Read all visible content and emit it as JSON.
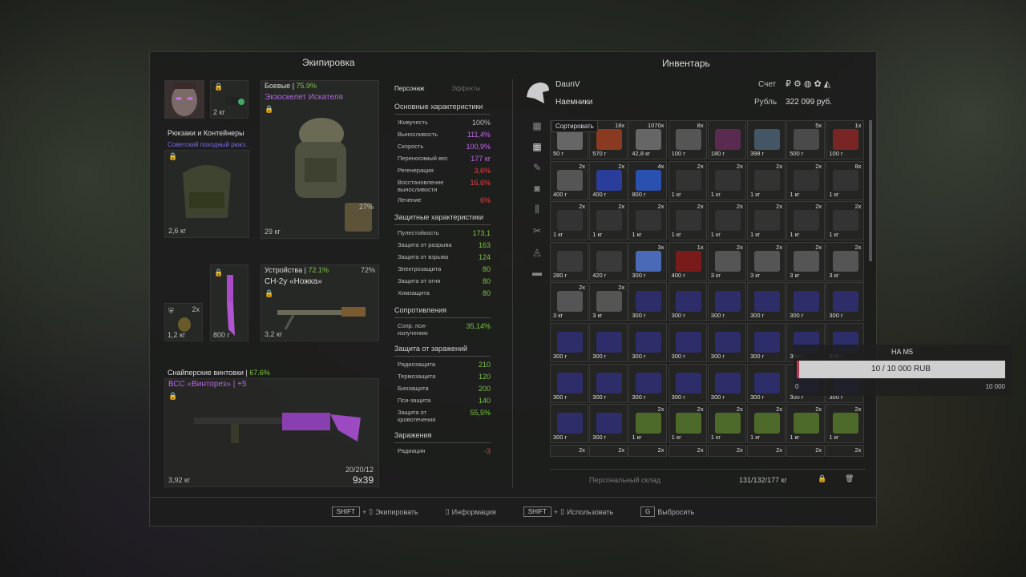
{
  "equipment_title": "Экипировка",
  "inventory_title": "Инвентарь",
  "equipment": {
    "char_weight": "2 кг",
    "backpack_section": "Рюкзаки и Контейнеры",
    "backpack_name": "Советский походный рюкз.",
    "backpack_weight": "2,6 кг",
    "armor_label": "Боевые",
    "armor_pct": "75.9%",
    "armor_name": "Экзоскелет Искателя",
    "armor_weight": "29 кг",
    "armor_badge": "27%",
    "grenade_count": "2х",
    "grenade_weight": "1,2 кг",
    "knife_weight": "800 г",
    "device_label": "Устройства",
    "device_pct": "72.1%",
    "device_badge": "72%",
    "device_name": "СН-2у «Ножка»",
    "device_weight": "3,2 кг",
    "rifle_section": "Снайперские винтовки",
    "rifle_pct": "67.6%",
    "rifle_name": "ВСС «Винторез»",
    "rifle_plus": "+5",
    "rifle_weight": "3,92 кг",
    "rifle_ammo": "20/20/12",
    "rifle_caliber": "9х39"
  },
  "stats": {
    "tab1": "Персонаж",
    "tab2": "Эффекты",
    "basic_title": "Основные характеристики",
    "basic": [
      {
        "k": "Живучесть",
        "v": "100%",
        "cls": "w"
      },
      {
        "k": "Выносливость",
        "v": "111,4%",
        "cls": "p"
      },
      {
        "k": "Скорость",
        "v": "100,9%",
        "cls": "p"
      },
      {
        "k": "Переносимый вес",
        "v": "177 кг",
        "cls": "p"
      },
      {
        "k": "Регенерация",
        "v": "3,6%",
        "cls": "r"
      },
      {
        "k": "Восстановление выносливости",
        "v": "16,6%",
        "cls": "r"
      },
      {
        "k": "Лечение",
        "v": "6%",
        "cls": "r"
      }
    ],
    "protect_title": "Защитные характеристики",
    "protect": [
      {
        "k": "Пулестойкость",
        "v": "173,1",
        "cls": "g"
      },
      {
        "k": "Защита от разрыва",
        "v": "163",
        "cls": "g"
      },
      {
        "k": "Защита от взрыва",
        "v": "124",
        "cls": "g"
      },
      {
        "k": "Электрозащита",
        "v": "80",
        "cls": "g"
      },
      {
        "k": "Защита от огня",
        "v": "80",
        "cls": "g"
      },
      {
        "k": "Химзащита",
        "v": "80",
        "cls": "g"
      }
    ],
    "resist_title": "Сопротивления",
    "resist": [
      {
        "k": "Сопр. пси-излучению",
        "v": "35,14%",
        "cls": "g"
      }
    ],
    "contam_title": "Защита от заражений",
    "contam": [
      {
        "k": "Радиозащита",
        "v": "210",
        "cls": "g"
      },
      {
        "k": "Термозащита",
        "v": "120",
        "cls": "g"
      },
      {
        "k": "Биозащита",
        "v": "200",
        "cls": "g"
      },
      {
        "k": "Пси-защита",
        "v": "140",
        "cls": "g"
      },
      {
        "k": "Защита от кровотечения",
        "v": "55,5%",
        "cls": "g"
      }
    ],
    "infect_title": "Заражения",
    "infect": [
      {
        "k": "Радиация",
        "v": "-3",
        "cls": "r"
      }
    ]
  },
  "inventory": {
    "player_name": "DaunV",
    "faction": "Наемники",
    "account_label": "Счет",
    "currency_label": "Рубль",
    "money": "322 099 руб.",
    "sort_tooltip": "Сортировать",
    "storage_label": "Персональный склад",
    "weight_summary": "131/132/177 кг",
    "cells": [
      {
        "w": "50 г",
        "c": "",
        "col": "#666"
      },
      {
        "w": "570 г",
        "c": "18х",
        "col": "#8a3a20"
      },
      {
        "w": "42,8 кг",
        "c": "1070х",
        "col": "#666"
      },
      {
        "w": "100 г",
        "c": "8х",
        "col": "#555"
      },
      {
        "w": "180 г",
        "c": "",
        "col": "#5a2a50"
      },
      {
        "w": "398 г",
        "c": "",
        "col": "#456"
      },
      {
        "w": "500 г",
        "c": "5х",
        "col": "#4a4a4a"
      },
      {
        "w": "100 г",
        "c": "1х",
        "col": "#7a2525"
      },
      {
        "w": "400 г",
        "c": "2х",
        "col": "#555"
      },
      {
        "w": "400 г",
        "c": "2х",
        "col": "#2b3d9a"
      },
      {
        "w": "800 г",
        "c": "4х",
        "col": "#2a50b0"
      },
      {
        "w": "1 кг",
        "c": "2х",
        "col": "#333"
      },
      {
        "w": "1 кг",
        "c": "2х",
        "col": "#333"
      },
      {
        "w": "1 кг",
        "c": "2х",
        "col": "#333"
      },
      {
        "w": "1 кг",
        "c": "2х",
        "col": "#333"
      },
      {
        "w": "1 кг",
        "c": "8х",
        "col": "#333"
      },
      {
        "w": "1 кг",
        "c": "2х",
        "col": "#333"
      },
      {
        "w": "1 кг",
        "c": "2х",
        "col": "#333"
      },
      {
        "w": "1 кг",
        "c": "2х",
        "col": "#333"
      },
      {
        "w": "1 кг",
        "c": "2х",
        "col": "#333"
      },
      {
        "w": "1 кг",
        "c": "2х",
        "col": "#333"
      },
      {
        "w": "1 кг",
        "c": "2х",
        "col": "#333"
      },
      {
        "w": "1 кг",
        "c": "2х",
        "col": "#333"
      },
      {
        "w": "1 кг",
        "c": "2х",
        "col": "#333"
      },
      {
        "w": "280 г",
        "c": "",
        "col": "#3a3a3a"
      },
      {
        "w": "420 г",
        "c": "",
        "col": "#3a3a3a"
      },
      {
        "w": "300 г",
        "c": "3х",
        "col": "#4a6ab8"
      },
      {
        "w": "400 г",
        "c": "1х",
        "col": "#7a1b1b"
      },
      {
        "w": "3 кг",
        "c": "2х",
        "col": "#555"
      },
      {
        "w": "3 кг",
        "c": "2х",
        "col": "#555"
      },
      {
        "w": "3 кг",
        "c": "2х",
        "col": "#555"
      },
      {
        "w": "3 кг",
        "c": "2х",
        "col": "#555"
      },
      {
        "w": "3 кг",
        "c": "2х",
        "col": "#555"
      },
      {
        "w": "3 кг",
        "c": "2х",
        "col": "#555"
      },
      {
        "w": "300 г",
        "c": "",
        "col": "#2d2d6a"
      },
      {
        "w": "300 г",
        "c": "",
        "col": "#2d2d6a"
      },
      {
        "w": "300 г",
        "c": "",
        "col": "#2d2d6a"
      },
      {
        "w": "300 г",
        "c": "",
        "col": "#2d2d6a"
      },
      {
        "w": "300 г",
        "c": "",
        "col": "#2d2d6a"
      },
      {
        "w": "300 г",
        "c": "",
        "col": "#2d2d6a"
      },
      {
        "w": "300 г",
        "c": "",
        "col": "#2d2d6a"
      },
      {
        "w": "300 г",
        "c": "",
        "col": "#2d2d6a"
      },
      {
        "w": "300 г",
        "c": "",
        "col": "#2d2d6a"
      },
      {
        "w": "300 г",
        "c": "",
        "col": "#2d2d6a"
      },
      {
        "w": "300 г",
        "c": "",
        "col": "#2d2d6a"
      },
      {
        "w": "300 г",
        "c": "",
        "col": "#2d2d6a"
      },
      {
        "w": "300 г",
        "c": "",
        "col": "#2d2d6a"
      },
      {
        "w": "300 г",
        "c": "",
        "col": "#2d2d6a"
      },
      {
        "w": "300 г",
        "c": "",
        "col": "#2d2d6a"
      },
      {
        "w": "300 г",
        "c": "",
        "col": "#2d2d6a"
      },
      {
        "w": "300 г",
        "c": "",
        "col": "#2d2d6a"
      },
      {
        "w": "300 г",
        "c": "",
        "col": "#2d2d6a"
      },
      {
        "w": "300 г",
        "c": "",
        "col": "#2d2d6a"
      },
      {
        "w": "300 г",
        "c": "",
        "col": "#2d2d6a"
      },
      {
        "w": "300 г",
        "c": "",
        "col": "#2d2d6a"
      },
      {
        "w": "300 г",
        "c": "",
        "col": "#2d2d6a"
      },
      {
        "w": "300 г",
        "c": "",
        "col": "#2d2d6a"
      },
      {
        "w": "300 г",
        "c": "",
        "col": "#2d2d6a"
      },
      {
        "w": "1 кг",
        "c": "2х",
        "col": "#4e6a2a"
      },
      {
        "w": "1 кг",
        "c": "2х",
        "col": "#4e6a2a"
      },
      {
        "w": "1 кг",
        "c": "2х",
        "col": "#4e6a2a"
      },
      {
        "w": "1 кг",
        "c": "2х",
        "col": "#4e6a2a"
      },
      {
        "w": "1 кг",
        "c": "2х",
        "col": "#4e6a2a"
      },
      {
        "w": "1 кг",
        "c": "2х",
        "col": "#4e6a2a"
      }
    ],
    "partial_row_counts": [
      "2х",
      "2х",
      "2х",
      "2х",
      "2х",
      "2х",
      "2х",
      "2х"
    ]
  },
  "tooltip": {
    "title": "HA M5",
    "value": "10 / 10 000 RUB",
    "min": "0",
    "max": "10 000",
    "fill_fraction": 0.001
  },
  "footer": {
    "shift1": "SHIFT",
    "equip": "Экипировать",
    "info": "Информация",
    "shift2": "SHIFT",
    "use": "Использовать",
    "drop": "Выбросить"
  }
}
